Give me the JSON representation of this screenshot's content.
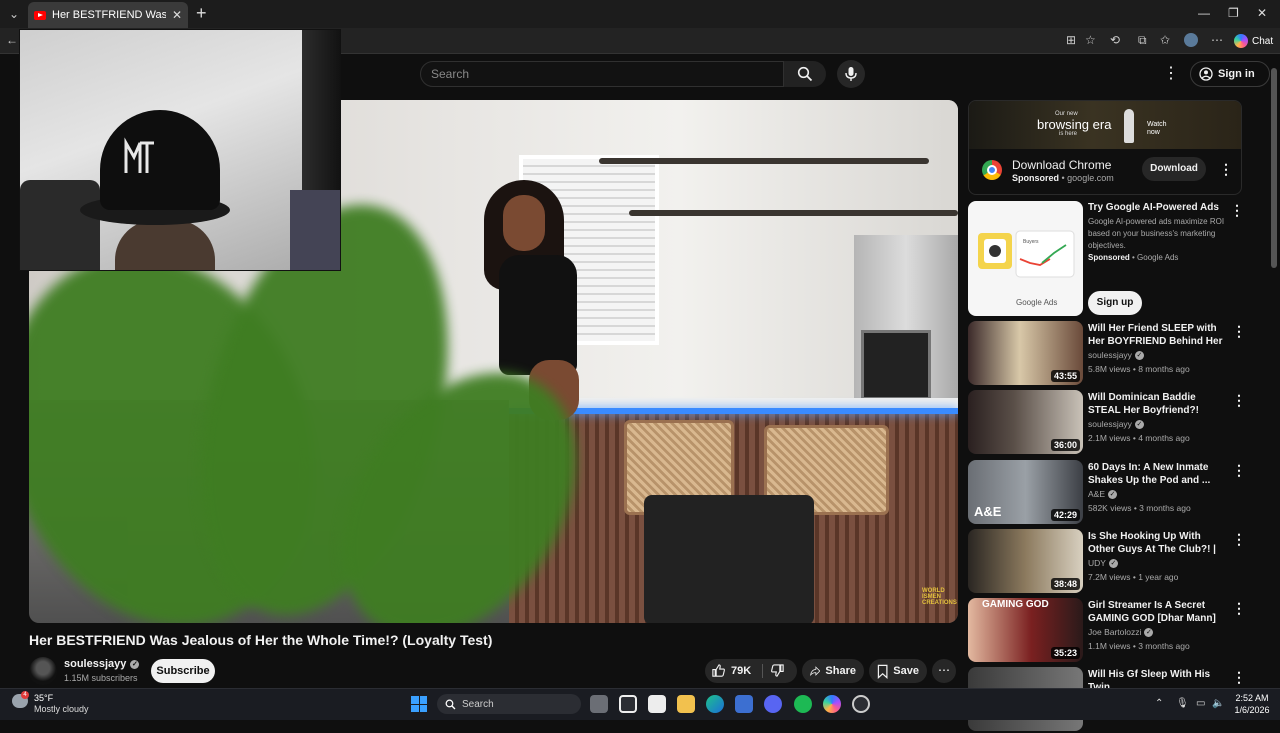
{
  "browser": {
    "tab_title": "Her BESTFRIEND Was Jealous of Her",
    "chat_label": "Chat"
  },
  "youtube": {
    "search_placeholder": "Search",
    "sign_in": "Sign in"
  },
  "video": {
    "title": "Her BESTFRIEND Was Jealous of Her the Whole Time!? (Loyalty Test)",
    "watermark": "WORLD ISMEN CREATIONS",
    "channel": "soulessjayy",
    "subscribers": "1.15M subscribers",
    "subscribe_label": "Subscribe",
    "likes": "79K",
    "share_label": "Share",
    "save_label": "Save"
  },
  "ads": {
    "chrome": {
      "banner_small_top": "Our new",
      "banner_big": "browsing era",
      "banner_small_bottom": "is here",
      "banner_watch": "Watch now",
      "title": "Download Chrome",
      "sponsored": "Sponsored",
      "domain": "google.com",
      "button": "Download"
    },
    "google_ads": {
      "title": "Try Google AI-Powered Ads",
      "description": "Google AI-powered ads maximize ROI based on your business's marketing objectives.",
      "sponsored": "Sponsored",
      "advertiser": "Google Ads",
      "button": "Sign up",
      "image_label": "Google Ads",
      "image_caption": "Buyers"
    }
  },
  "recommendations": [
    {
      "title": "Will Her Friend SLEEP with Her BOYFRIEND Behind Her Back!?...",
      "channel": "soulessjayy",
      "verified": true,
      "meta": "5.8M views • 8 months ago",
      "duration": "43:55",
      "thumb_text": ""
    },
    {
      "title": "Will Dominican Baddie STEAL Her Boyfriend?! (Loyalty Test)",
      "channel": "soulessjayy",
      "verified": true,
      "meta": "2.1M views • 4 months ago",
      "duration": "36:00",
      "thumb_text": ""
    },
    {
      "title": "60 Days In: A New Inmate Shakes Up the Pod and ...",
      "channel": "A&E",
      "verified": true,
      "meta": "582K views • 3 months ago",
      "duration": "42:29",
      "thumb_text": "A&E"
    },
    {
      "title": "Is She Hooking Up With Other Guys At The Club?! | UDY ...",
      "channel": "UDY",
      "verified": true,
      "meta": "7.2M views • 1 year ago",
      "duration": "38:48",
      "thumb_text": ""
    },
    {
      "title": "Girl Streamer Is A Secret GAMING GOD [Dhar Mann]",
      "channel": "Joe Bartolozzi",
      "verified": true,
      "meta": "1.1M views • 3 months ago",
      "duration": "35:23",
      "thumb_text": "GAMING GOD"
    },
    {
      "title": "Will His Gf Sleep With His Twin",
      "channel": "",
      "verified": false,
      "meta": "",
      "duration": "",
      "thumb_text": ""
    }
  ],
  "taskbar": {
    "temperature": "35°F",
    "weather": "Mostly cloudy",
    "weather_badge": "4",
    "search_label": "Search",
    "time": "2:52 AM",
    "date": "1/6/2026"
  },
  "colors": {
    "accent_red": "#ff0000",
    "background": "#0f0f0f",
    "text": "#f1f1f1",
    "muted": "#aaaaaa"
  }
}
